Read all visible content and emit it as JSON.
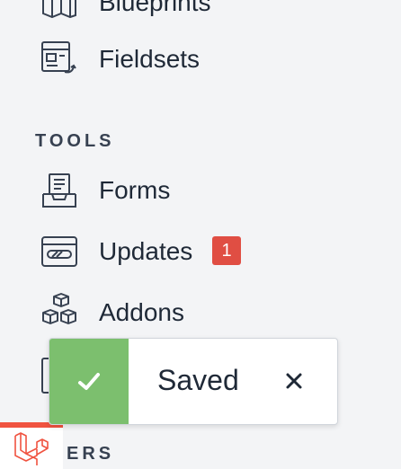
{
  "sidebar": {
    "content_items": [
      {
        "label": "Blueprints",
        "icon": "blueprint-icon"
      },
      {
        "label": "Fieldsets",
        "icon": "fieldset-icon"
      }
    ],
    "tools_heading": "TOOLS",
    "tools_items": [
      {
        "label": "Forms",
        "icon": "inbox-form-icon"
      },
      {
        "label": "Updates",
        "icon": "updates-window-icon",
        "badge": "1"
      },
      {
        "label": "Addons",
        "icon": "cubes-icon"
      }
    ],
    "users_heading_partial": "ERS"
  },
  "toast": {
    "message": "Saved",
    "close_symbol": "×",
    "status": "success",
    "accent_color": "#7cbf6e"
  },
  "colors": {
    "badge": "#e04e43",
    "brand": "#f05340"
  }
}
